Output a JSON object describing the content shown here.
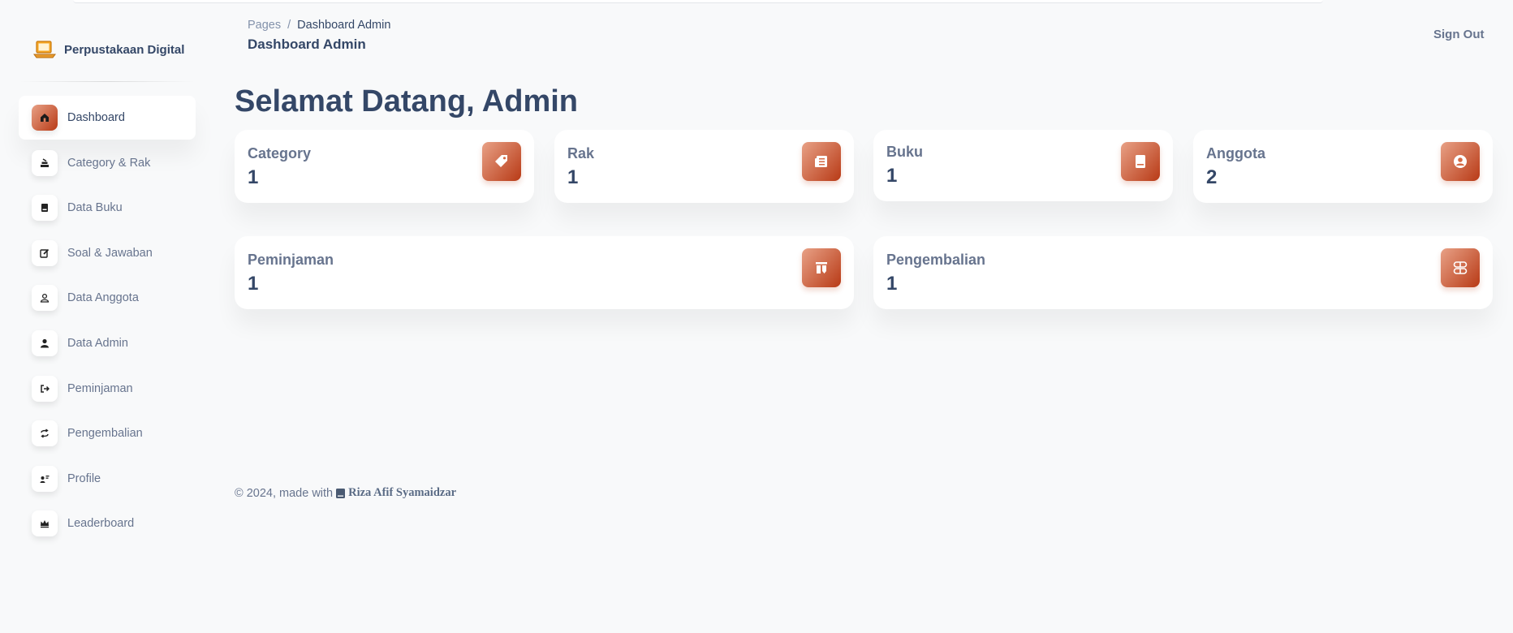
{
  "brand": {
    "name": "Perpustakaan Digital",
    "icon": "laptop-icon"
  },
  "sidebar": {
    "items": [
      {
        "label": "Dashboard",
        "icon": "home-icon",
        "active": true
      },
      {
        "label": "Category & Rak",
        "icon": "category-icon",
        "active": false
      },
      {
        "label": "Data Buku",
        "icon": "book-icon",
        "active": false
      },
      {
        "label": "Soal & Jawaban",
        "icon": "edit-icon",
        "active": false
      },
      {
        "label": "Data Anggota",
        "icon": "user-outline-icon",
        "active": false
      },
      {
        "label": "Data Admin",
        "icon": "user-icon",
        "active": false
      },
      {
        "label": "Peminjaman",
        "icon": "sign-out-icon",
        "active": false
      },
      {
        "label": "Pengembalian",
        "icon": "refresh-icon",
        "active": false
      },
      {
        "label": "Profile",
        "icon": "profile-icon",
        "active": false
      },
      {
        "label": "Leaderboard",
        "icon": "crown-icon",
        "active": false
      }
    ]
  },
  "header": {
    "breadcrumb_root": "Pages",
    "breadcrumb_separator": "/",
    "breadcrumb_current": "Dashboard Admin",
    "title": "Dashboard Admin",
    "sign_out": "Sign Out"
  },
  "main": {
    "welcome": "Selamat Datang, Admin",
    "stats": [
      {
        "label": "Category",
        "value": "1",
        "icon": "tag-icon"
      },
      {
        "label": "Rak",
        "value": "1",
        "icon": "newspaper-icon"
      },
      {
        "label": "Buku",
        "value": "1",
        "icon": "book-icon"
      },
      {
        "label": "Anggota",
        "value": "2",
        "icon": "user-circle-icon"
      },
      {
        "label": "Peminjaman",
        "value": "1",
        "icon": "columns-icon"
      },
      {
        "label": "Pengembalian",
        "value": "1",
        "icon": "grid-icon"
      }
    ]
  },
  "footer": {
    "text": "© 2024, made with",
    "author": "Riza Afif Syamaidzar"
  },
  "colors": {
    "accent_start": "#b83a16",
    "accent_end": "#e8a186",
    "text_dark": "#344767",
    "text_muted": "#67748e",
    "background": "#f8f9fa"
  }
}
